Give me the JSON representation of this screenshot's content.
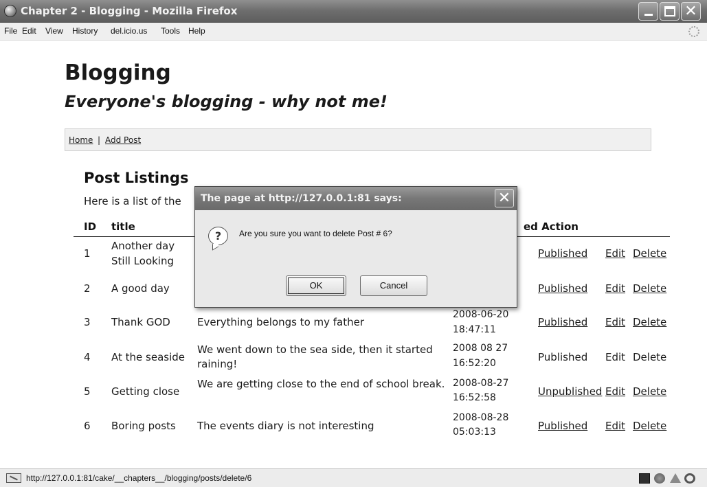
{
  "window": {
    "title": "Chapter 2 - Blogging - Mozilla Firefox",
    "close_glyph": "✕"
  },
  "menu": {
    "items": [
      "File",
      "Edit",
      "View",
      "History",
      "del.icio.us",
      "Tools",
      "Help"
    ]
  },
  "page": {
    "site_title": "Blogging",
    "tagline": "Everyone's blogging - why not me!",
    "nav": {
      "home": "Home",
      "separator": "|",
      "add_post": "Add Post"
    },
    "section_title": "Post Listings",
    "intro": "Here is a list of the",
    "table": {
      "headers": {
        "id": "ID",
        "title": "title",
        "action": "ed Action"
      },
      "rows": [
        {
          "id": "1",
          "title_line1": "Another day",
          "title_line2": "Still Looking",
          "body": "",
          "created_line1": "",
          "created_line2": "",
          "status": "Published",
          "edit": "Edit",
          "delete": "Delete"
        },
        {
          "id": "2",
          "title_line1": "A good day",
          "title_line2": "",
          "body": "",
          "created_line1": "",
          "created_line2": "",
          "status": "Published",
          "edit": "Edit",
          "delete": "Delete"
        },
        {
          "id": "3",
          "title_line1": "Thank GOD",
          "title_line2": "",
          "body": "Everything belongs to my father",
          "created_line1": "2008-06-20",
          "created_line2": "18:47:11",
          "status": "Published",
          "edit": "Edit",
          "delete": "Delete"
        },
        {
          "id": "4",
          "title_line1": "At the seaside",
          "title_line2": "",
          "body": "We went down to the sea side, then it started raining!",
          "created_line1": "2008 08 27",
          "created_line2": "16:52:20",
          "status": "Published",
          "edit": "Edit",
          "delete": "Delete"
        },
        {
          "id": "5",
          "title_line1": "Getting close",
          "title_line2": "",
          "body": "We are getting close to the end of school break.",
          "created_line1": "2008-08-27",
          "created_line2": "16:52:58",
          "status": "Unpublished",
          "edit": "Edit",
          "delete": "Delete"
        },
        {
          "id": "6",
          "title_line1": "Boring posts",
          "title_line2": "",
          "body": "The events diary is not interesting",
          "created_line1": "2008-08-28",
          "created_line2": "05:03:13",
          "status": "Published",
          "edit": "Edit",
          "delete": "Delete"
        }
      ]
    }
  },
  "dialog": {
    "title": "The page at http://127.0.0.1:81 says:",
    "close_glyph": "✕",
    "icon_glyph": "?",
    "message": "Are you sure you want to delete Post # 6?",
    "ok_label": "OK",
    "cancel_label": "Cancel"
  },
  "statusbar": {
    "url": "http://127.0.0.1:81/cake/__chapters__/blogging/posts/delete/6"
  }
}
